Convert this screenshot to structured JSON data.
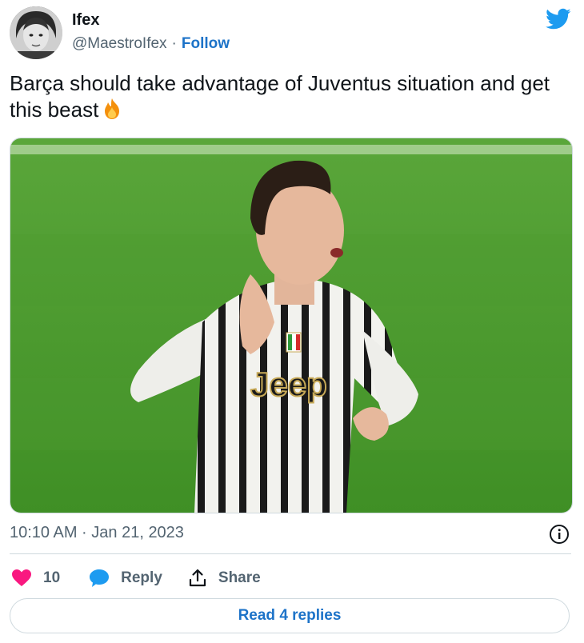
{
  "author": {
    "display_name": "Ifex",
    "handle": "@MaestroIfex",
    "separator": "·",
    "follow_label": "Follow"
  },
  "tweet": {
    "text": "Barça should take advantage of Juventus situation and get this beast",
    "emoji_icon": "fire-icon",
    "media_jersey_text": "Jeep"
  },
  "meta": {
    "timestamp": "10:10 AM · Jan 21, 2023"
  },
  "actions": {
    "like_count": "10",
    "reply_label": "Reply",
    "share_label": "Share"
  },
  "read_replies_label": "Read 4 replies",
  "colors": {
    "brand_blue": "#1d9bf0",
    "link_blue": "#1d73c8",
    "like_pink": "#f91880",
    "muted": "#536471",
    "pitch_green": "#4a9a2c"
  }
}
